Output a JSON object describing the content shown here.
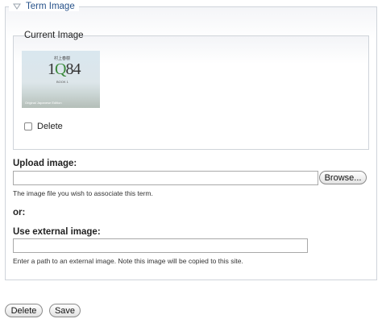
{
  "term_image": {
    "legend": "Term Image",
    "current_image": {
      "legend": "Current Image",
      "thumb": {
        "small_text": "村上春樹",
        "title_prefix": "1",
        "title_q": "Q",
        "title_suffix": "84",
        "sub_text": "BOOK 1",
        "foot_text": "Original Japanese Edition"
      },
      "delete_label": "Delete",
      "delete_checked": false
    },
    "upload": {
      "label": "Upload image:",
      "value": "",
      "browse_label": "Browse...",
      "description": "The image file you wish to associate this term."
    },
    "or_label": "or:",
    "external": {
      "label": "Use external image:",
      "value": "",
      "description": "Enter a path to an external image. Note this image will be copied to this site."
    }
  },
  "actions": {
    "delete_label": "Delete",
    "save_label": "Save"
  }
}
